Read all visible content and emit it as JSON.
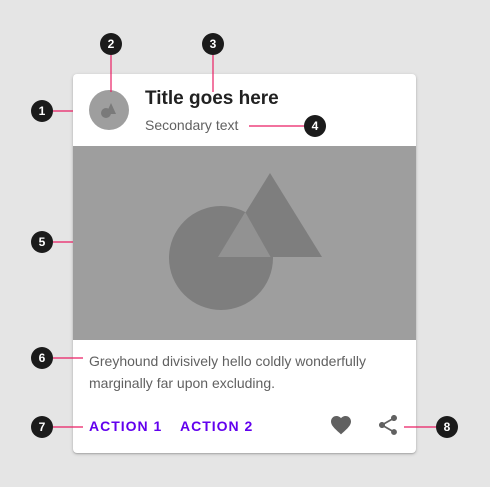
{
  "card": {
    "title": "Title goes here",
    "secondary_text": "Secondary text",
    "supporting_text": "Greyhound divisively hello coldly wonderfully marginally far upon excluding.",
    "actions": [
      "ACTION 1",
      "ACTION 2"
    ],
    "icons": [
      "favorite-icon",
      "share-icon"
    ]
  },
  "callouts": [
    "1",
    "2",
    "3",
    "4",
    "5",
    "6",
    "7",
    "8"
  ],
  "colors": {
    "accent": "#6200ee",
    "placeholder": "#9e9e9e",
    "callout": "#1b1b1b",
    "leader": "#e91e63"
  }
}
